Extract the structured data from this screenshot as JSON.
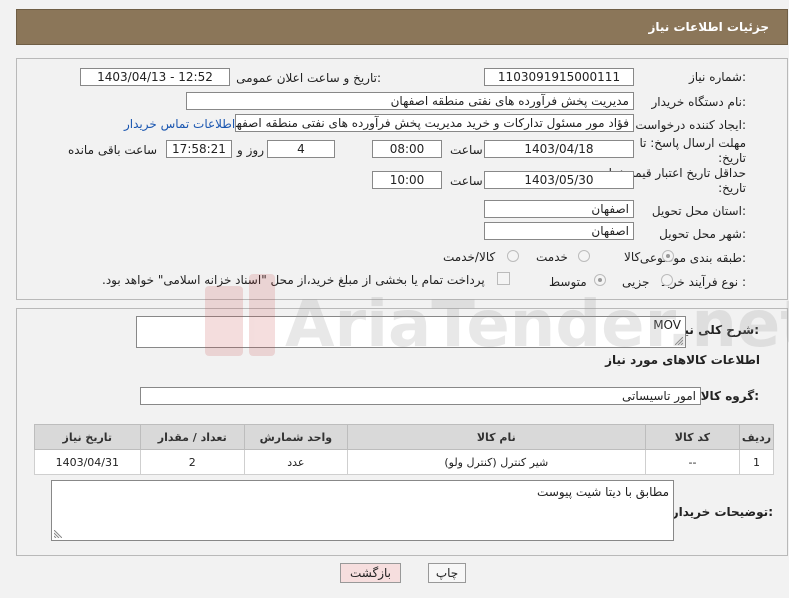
{
  "header": {
    "title": "جزئیات اطلاعات نیاز"
  },
  "form": {
    "need_number_label": "شماره نیاز:",
    "need_number": "1103091915000111",
    "announce_label": "تاریخ و ساعت اعلان عمومی:",
    "announce_value": "1403/04/13 - 12:52",
    "buyer_org_label": "نام دستگاه خریدار:",
    "buyer_org": "مدیریت پخش فرآورده های نفتی منطقه اصفهان",
    "creator_label": "ایجاد کننده درخواست:",
    "creator": "فؤاد مور مسئول تدارکات و خرید مدیریت پخش فرآورده های نفتی منطقه اصفهان",
    "contact_link": "اطلاعات تماس خریدار",
    "deadline_label": "مهلت ارسال پاسخ: تا تاریخ:",
    "deadline_date": "1403/04/18",
    "time_label": "ساعت",
    "deadline_time": "08:00",
    "days_value": "4",
    "days_label": "روز و",
    "remaining_time": "17:58:21",
    "remaining_label": "ساعت باقی مانده",
    "price_validity_label": "حداقل تاریخ اعتبار قیمت: تا تاریخ:",
    "price_validity_date": "1403/05/30",
    "price_validity_time": "10:00",
    "province_label": "استان محل تحویل:",
    "province": "اصفهان",
    "city_label": "شهر محل تحویل:",
    "city": "اصفهان",
    "category_label": "طبقه بندی موضوعی:",
    "category_options": [
      "کالا",
      "خدمت",
      "کالا/خدمت"
    ],
    "category_selected": "کالا",
    "process_label": "نوع فرآیند خرید :",
    "process_options": [
      "جزیی",
      "متوسط"
    ],
    "process_selected": "متوسط",
    "payment_note": "پرداخت تمام یا بخشی از مبلغ خرید،از محل \"اسناد خزانه اسلامی\" خواهد بود."
  },
  "description": {
    "label": "شرح کلی نیاز:",
    "value": "MOV"
  },
  "goods": {
    "section_title": "اطلاعات کالاهای مورد نیاز",
    "group_label": "گروه کالا:",
    "group_value": "امور تاسیساتی",
    "columns": [
      "ردیف",
      "کد کالا",
      "نام کالا",
      "واحد شمارش",
      "تعداد / مقدار",
      "تاریخ نیاز"
    ],
    "rows": [
      {
        "row": "1",
        "code": "--",
        "name": "شیر کنترل (کنترل ولو)",
        "unit": "عدد",
        "qty": "2",
        "date": "1403/04/31"
      }
    ]
  },
  "buyer_notes": {
    "label": "توضیحات خریدار:",
    "value": "مطابق با دیتا شیت پیوست"
  },
  "buttons": {
    "print": "چاپ",
    "back": "بازگشت"
  },
  "watermark": {
    "text": "AriaTender.net"
  },
  "colors": {
    "header_bg": "#8b7659",
    "link": "#1a56b0",
    "back_button_bg": "#f6dede"
  }
}
